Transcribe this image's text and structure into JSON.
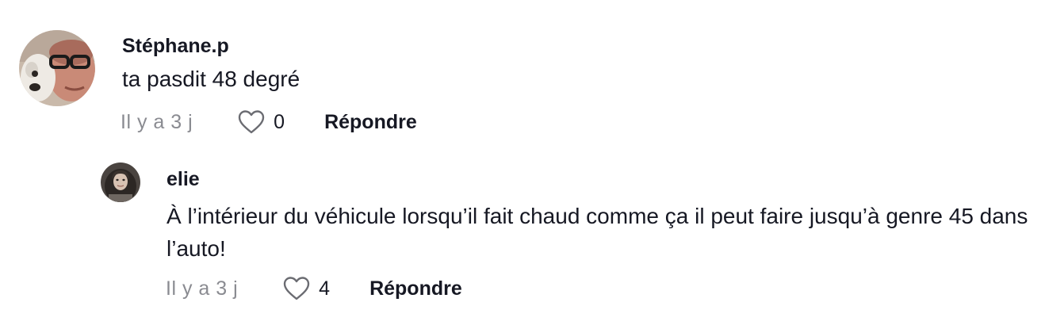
{
  "comments": [
    {
      "username": "Stéphane.p",
      "text": "ta pasdit 48 degré",
      "time": "Il y a 3 j",
      "likes": "0",
      "reply_label": "Répondre",
      "avatar_icon": "user-avatar-dog-man"
    },
    {
      "username": "elie",
      "text": "À l’intérieur du véhicule lorsqu’il fait chaud comme ça il peut faire jusqu’à genre 45 dans l’auto!",
      "time": "Il y a 3 j",
      "likes": "4",
      "reply_label": "Répondre",
      "avatar_icon": "user-avatar-woman"
    }
  ],
  "colors": {
    "text": "#161823",
    "muted": "#8a8b91",
    "background": "#ffffff"
  }
}
